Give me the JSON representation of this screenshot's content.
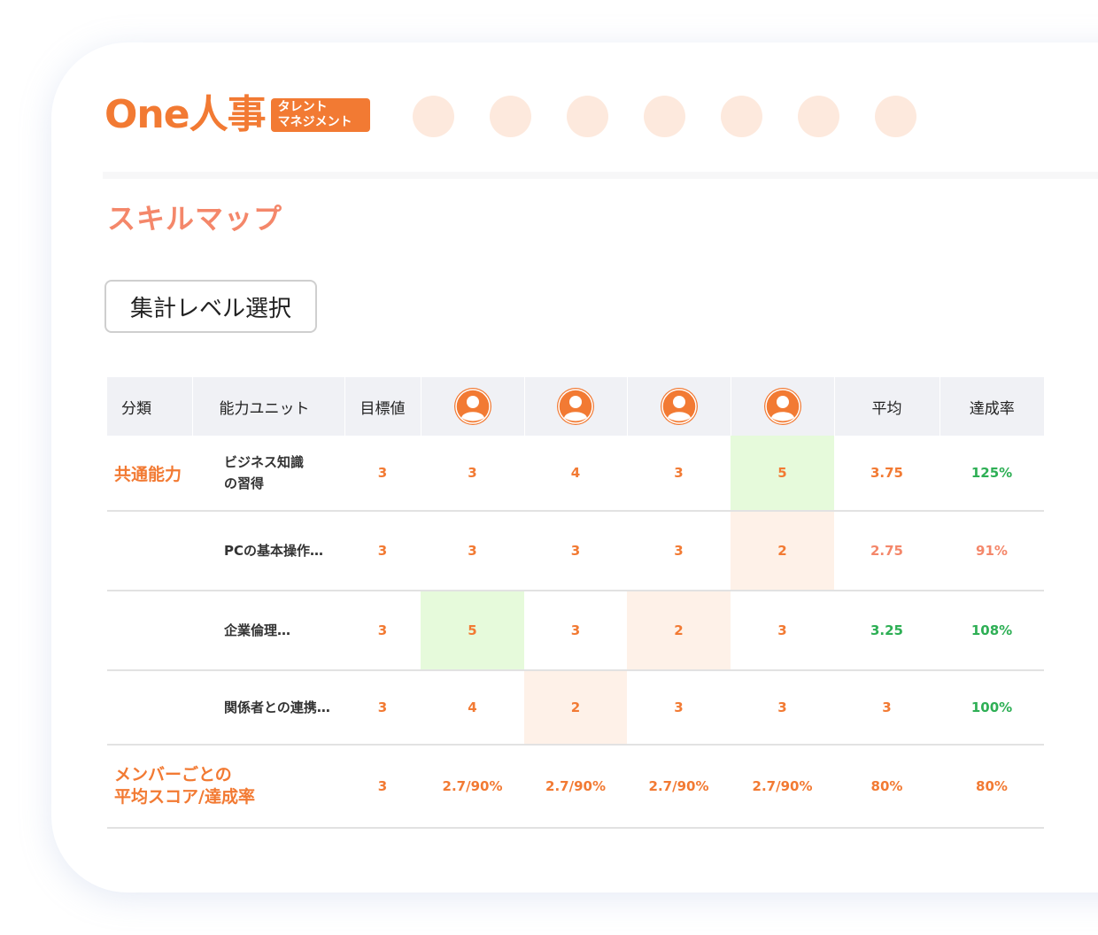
{
  "header": {
    "logo_main": "One人事",
    "logo_badge_line1": "タレント",
    "logo_badge_line2": "マネジメント",
    "nav_dot_count": 7
  },
  "page": {
    "title": "スキルマップ",
    "level_select_label": "集計レベル選択"
  },
  "table": {
    "headers": {
      "category": "分類",
      "unit": "能力ユニット",
      "target": "目標値",
      "members": [
        "user-avatar-icon",
        "user-avatar-icon",
        "user-avatar-icon",
        "user-avatar-icon"
      ],
      "average": "平均",
      "achievement": "達成率"
    },
    "rows": [
      {
        "category": "共通能力",
        "unit_line1": "ビジネス知識",
        "unit_line2": "の習得",
        "target": "3",
        "scores": [
          "3",
          "4",
          "3",
          "5"
        ],
        "average": "3.75",
        "achievement": "125%"
      },
      {
        "category": "",
        "unit_line1": "PCの基本操作…",
        "unit_line2": "",
        "target": "3",
        "scores": [
          "3",
          "3",
          "3",
          "2"
        ],
        "average": "2.75",
        "achievement": "91%"
      },
      {
        "category": "",
        "unit_line1": "企業倫理…",
        "unit_line2": "",
        "target": "3",
        "scores": [
          "5",
          "3",
          "2",
          "3"
        ],
        "average": "3.25",
        "achievement": "108%"
      },
      {
        "category": "",
        "unit_line1": "関係者との連携…",
        "unit_line2": "",
        "target": "3",
        "scores": [
          "4",
          "2",
          "3",
          "3"
        ],
        "average": "3",
        "achievement": "100%"
      }
    ],
    "summary": {
      "label_line1": "メンバーごとの",
      "label_line2": "平均スコア/達成率",
      "target": "3",
      "member_scores": [
        "2.7/90%",
        "2.7/90%",
        "2.7/90%",
        "2.7/90%"
      ],
      "average": "80%",
      "achievement": "80%"
    }
  },
  "colors": {
    "brand_orange": "#f27a33",
    "title_salmon": "#f4876a",
    "above_target_green": "#2eaf55",
    "highlight_green_bg": "#e6fadb",
    "highlight_orange_bg": "#fef1e8",
    "header_bg": "#f0f1f5"
  }
}
